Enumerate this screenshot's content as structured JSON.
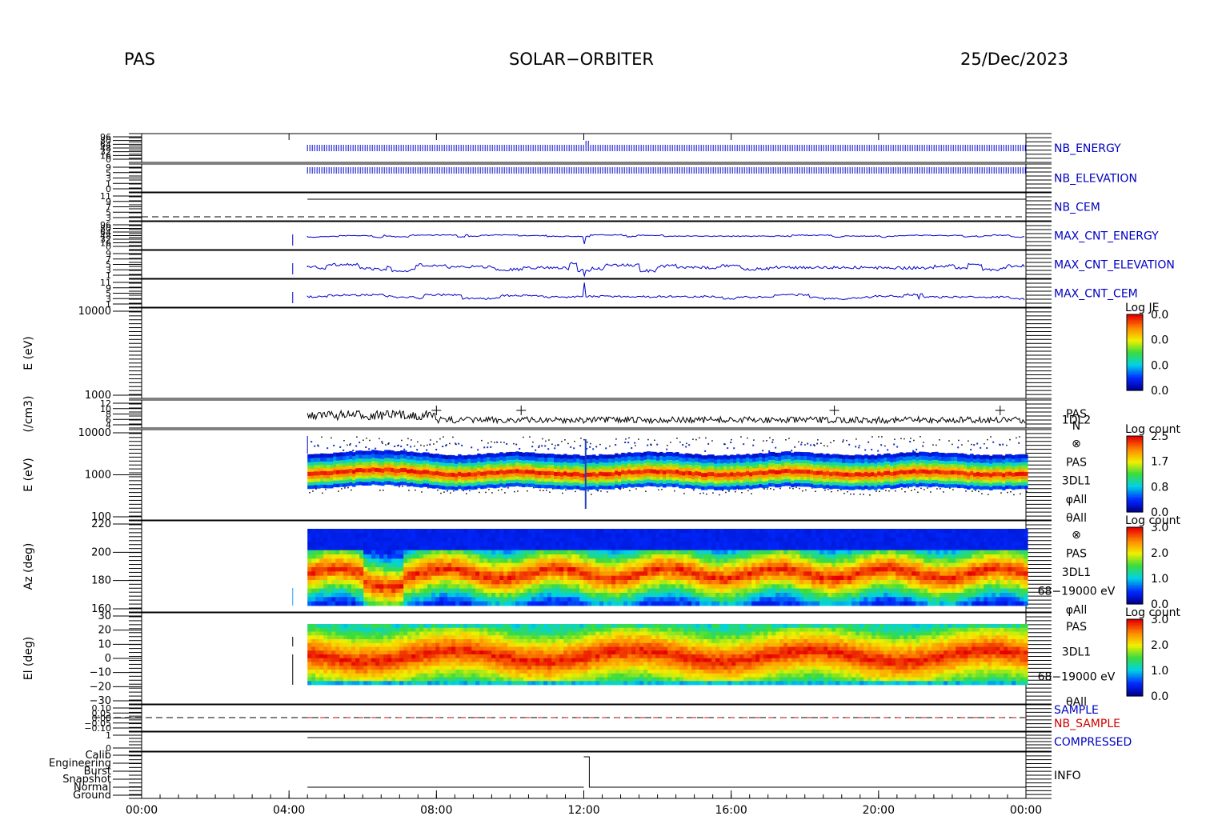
{
  "header": {
    "instrument": "PAS",
    "mission": "SOLAR−ORBITER",
    "date": "25/Dec/2023"
  },
  "colors": {
    "trace_blue": "#0000cc",
    "label_blue": "#0000c0",
    "label_red": "#d00000",
    "black": "#000000"
  },
  "chart_data": {
    "type": "heatmap",
    "x_ticks": [
      "00:00",
      "04:00",
      "08:00",
      "12:00",
      "16:00",
      "20:00",
      "00:00"
    ],
    "x_hours": [
      0,
      4,
      8,
      12,
      16,
      20,
      24
    ],
    "data_start_hour": 4.5,
    "panels": [
      {
        "id": "nb_energy",
        "label": "NB_ENERGY",
        "label_color": "#0000c0",
        "ticks": [
          "96",
          "80",
          "64",
          "48",
          "32",
          "16",
          "0"
        ],
        "trace": "dense-blue"
      },
      {
        "id": "nb_elevation",
        "label": "NB_ELEVATION",
        "label_color": "#0000c0",
        "ticks": [
          "9",
          "5",
          "3",
          "1",
          "0"
        ],
        "trace": "dense-blue"
      },
      {
        "id": "nb_cem",
        "label": "NB_CEM",
        "label_color": "#0000c0",
        "ticks": [
          "11",
          "9",
          "7",
          "5",
          "3"
        ],
        "trace": "flat"
      },
      {
        "id": "max_cnt_energy",
        "label": "MAX_CNT_ENERGY",
        "label_color": "#0000c0",
        "ticks": [
          "96",
          "80",
          "64",
          "48",
          "32",
          "16",
          "0"
        ],
        "trace": "line-blue"
      },
      {
        "id": "max_cnt_elevation",
        "label": "MAX_CNT_ELEVATION",
        "label_color": "#0000c0",
        "ticks": [
          "9",
          "7",
          "5",
          "3",
          "1"
        ],
        "trace": "line-blue"
      },
      {
        "id": "max_cnt_cem",
        "label": "MAX_CNT_CEM",
        "label_color": "#0000c0",
        "ticks": [
          "11",
          "9",
          "5",
          "3",
          "1"
        ],
        "trace": "line-blue"
      },
      {
        "id": "e_empty",
        "ylabel": "E (eV)",
        "ticks": [
          "10000",
          "1000"
        ],
        "colorbar": {
          "title": "Log JE",
          "ticks": [
            "0.0",
            "0.0",
            "0.0",
            "0.0"
          ]
        }
      },
      {
        "id": "density",
        "ylabel": "(/cm3)",
        "ticks": [
          "12",
          "10",
          "8",
          "6",
          "4"
        ],
        "side_label": [
          "PAS",
          "1DL2",
          "N"
        ]
      },
      {
        "id": "energy_spec",
        "ylabel": "E (eV)",
        "ticks": [
          "10000",
          "1000",
          "100"
        ],
        "side_label": [
          "⊗",
          "PAS",
          "3DL1",
          "φAll",
          "θAll"
        ],
        "colorbar": {
          "title": "Log count",
          "ticks": [
            "2.5",
            "1.7",
            "0.8",
            "0.0"
          ]
        }
      },
      {
        "id": "azimuth",
        "ylabel": "Az (deg)",
        "ticks": [
          "220",
          "200",
          "180",
          "160"
        ],
        "side_label": [
          "⊗",
          "PAS",
          "3DL1",
          "68−19000 eV",
          "φAll"
        ],
        "colorbar": {
          "title": "Log count",
          "ticks": [
            "3.0",
            "2.0",
            "1.0",
            "0.0"
          ]
        }
      },
      {
        "id": "elevation",
        "ylabel": "El (deg)",
        "ticks": [
          "30",
          "20",
          "10",
          "0",
          "−10",
          "−20",
          "−30"
        ],
        "side_label": [
          "PAS",
          "3DL1",
          "68−19000 eV",
          "θAll"
        ],
        "colorbar": {
          "title": "Log count",
          "ticks": [
            "3.0",
            "2.0",
            "1.0",
            "0.0"
          ]
        }
      },
      {
        "id": "sample",
        "label": "SAMPLE",
        "label2": "NB_SAMPLE",
        "label_color": "#0000c0",
        "label2_color": "#d00000",
        "ticks": [
          "0.10",
          "0.05",
          "0.00",
          "−0.05",
          "−0.10"
        ]
      },
      {
        "id": "compressed",
        "label": "COMPRESSED",
        "label_color": "#0000c0",
        "ticks": [
          "1",
          "0"
        ]
      },
      {
        "id": "info",
        "label": "INFO",
        "label_color": "#000000",
        "ticks": [
          "Calib",
          "Engineering",
          "Burst",
          "Snapshot",
          "Normal",
          "Ground"
        ]
      }
    ]
  }
}
